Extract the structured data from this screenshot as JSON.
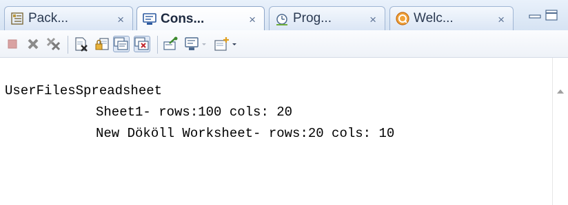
{
  "tabs": [
    {
      "label": "Pack...",
      "icon": "package-explorer-icon",
      "active": false
    },
    {
      "label": "Cons...",
      "icon": "console-icon",
      "active": true
    },
    {
      "label": "Prog...",
      "icon": "progress-icon",
      "active": false
    },
    {
      "label": "Welc...",
      "icon": "welcome-icon",
      "active": false
    }
  ],
  "close_glyph": "×",
  "toolbar": {
    "icons": [
      "terminate-icon",
      "remove-launch-icon",
      "remove-all-terminated-icon",
      "clear-console-icon",
      "scroll-lock-icon",
      "show-on-stdout-icon",
      "show-on-stderr-icon",
      "pin-console-icon",
      "display-console-icon",
      "open-console-icon"
    ]
  },
  "console": {
    "lines": [
      "UserFilesSpreadsheet",
      "Sheet1- rows:100 cols: 20",
      "New Dököll Worksheet- rows:20 cols: 10"
    ]
  },
  "colors": {
    "accent": "#8fa7c9",
    "tab_bg": "#dbe6f5",
    "terminate": "#d9a2a2"
  }
}
